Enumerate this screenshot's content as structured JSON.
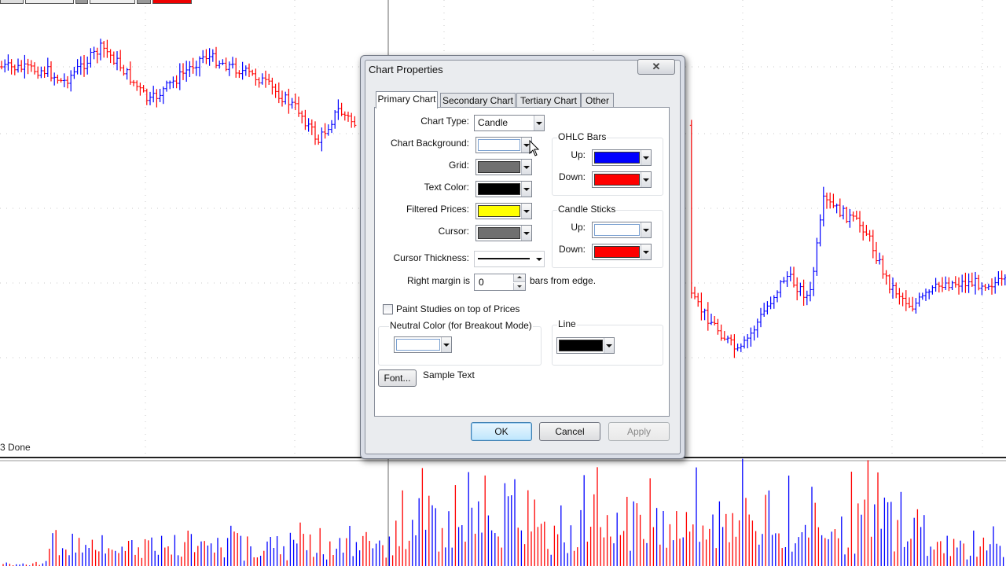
{
  "background": {
    "status_text": "3 Done",
    "up_color": "#0000ff",
    "down_color": "#ff0000"
  },
  "dialog": {
    "title": "Chart Properties",
    "close_icon": "close-x-icon",
    "tabs": [
      "Primary Chart",
      "Secondary Chart",
      "Tertiary Chart",
      "Other"
    ],
    "active_tab": "Primary Chart",
    "chart_type": {
      "label": "Chart Type:",
      "value": "Candle"
    },
    "chart_background": {
      "label": "Chart Background:",
      "color": "#ffffff"
    },
    "grid": {
      "label": "Grid:",
      "color": "#707070"
    },
    "text_color": {
      "label": "Text Color:",
      "color": "#000000"
    },
    "filtered_prices": {
      "label": "Filtered Prices:",
      "color": "#ffff00"
    },
    "cursor": {
      "label": "Cursor:",
      "color": "#707070"
    },
    "cursor_thickness": {
      "label": "Cursor Thickness:"
    },
    "right_margin": {
      "label": "Right margin is",
      "value": "0",
      "suffix": "bars from edge."
    },
    "ohlc_bars": {
      "title": "OHLC Bars",
      "up_label": "Up:",
      "up_color": "#0000ff",
      "down_label": "Down:",
      "down_color": "#ff0000"
    },
    "candle_sticks": {
      "title": "Candle Sticks",
      "up_label": "Up:",
      "up_color": "#ffffff",
      "down_label": "Down:",
      "down_color": "#ff0000"
    },
    "paint_studies": {
      "label": "Paint Studies on top of Prices",
      "checked": false
    },
    "neutral_color": {
      "title": "Neutral Color (for Breakout Mode)",
      "color": "#ffffff"
    },
    "line": {
      "title": "Line",
      "color": "#000000"
    },
    "font_button": "Font...",
    "sample_text": "Sample Text",
    "buttons": {
      "ok": "OK",
      "cancel": "Cancel",
      "apply": "Apply"
    }
  }
}
